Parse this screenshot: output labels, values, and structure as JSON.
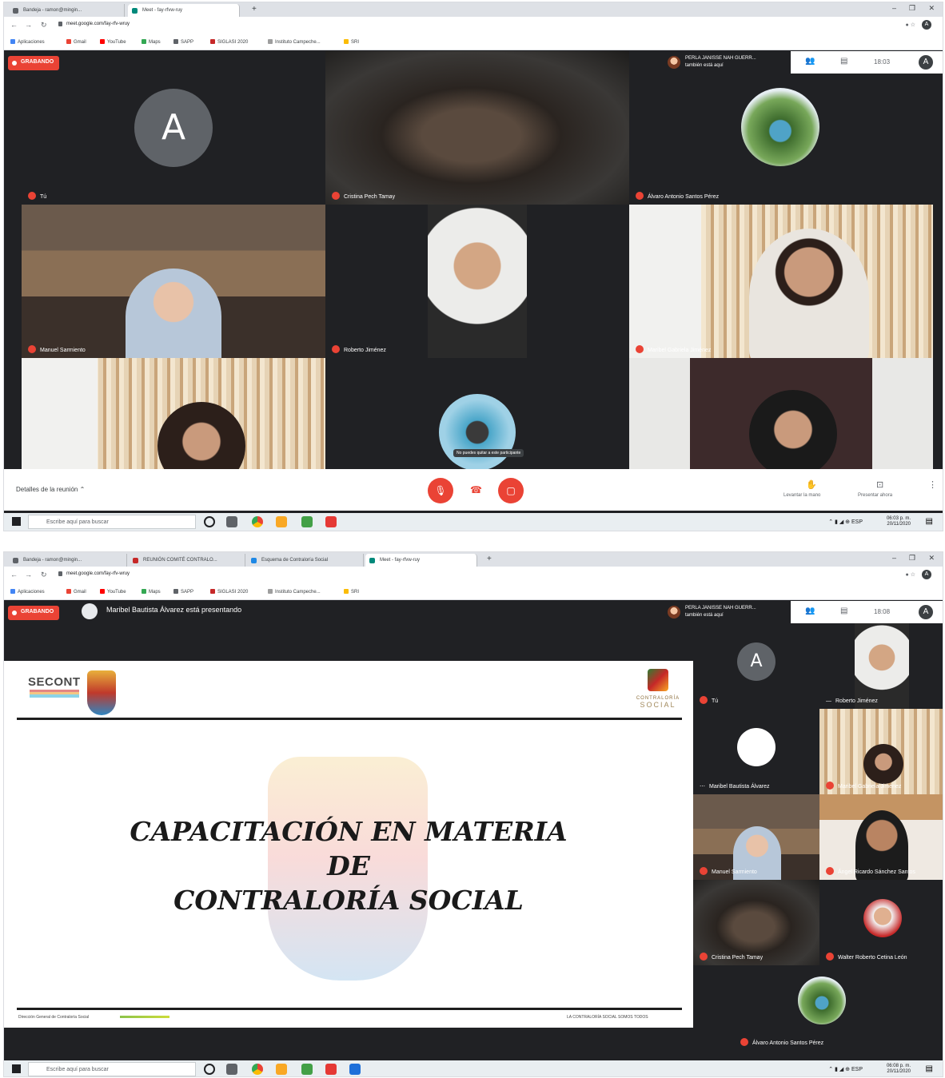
{
  "shot1": {
    "tabs": [
      {
        "label": "Bandeja - ramon@mingin..."
      },
      {
        "label": "Meet - fay-rfvw-ruy"
      }
    ],
    "url": "meet.google.com/fay-rfv-wruy",
    "bookmarks": [
      "Aplicaciones",
      "Gmail",
      "YouTube",
      "Maps",
      "SAPP",
      "SIGLASI 2020",
      "Instituto Campeche...",
      "SRI"
    ],
    "recording_label": "GRABANDO",
    "presenter": {
      "line1": "PERLA JANISSE NAH GUERR...",
      "line2": "también está aquí"
    },
    "clock": "18:03",
    "me_initial": "A",
    "tiles": [
      {
        "name": "Tú",
        "kind": "avatar",
        "initial": "A"
      },
      {
        "name": "Cristina Pech Tamay",
        "kind": "video"
      },
      {
        "name": "Álvaro Antonio Santos Pérez",
        "kind": "photo"
      },
      {
        "name": "Manuel Sarmiento",
        "kind": "video"
      },
      {
        "name": "Roberto Jiménez",
        "kind": "video"
      },
      {
        "name": "Maribel Gabriela Jiménez",
        "kind": "video"
      },
      {
        "name": "",
        "kind": "video"
      },
      {
        "name": "No puedes quitar a este participante",
        "kind": "photo"
      },
      {
        "name": "",
        "kind": "video"
      }
    ],
    "controls": {
      "details": "Detalles de la reunión",
      "raise_hand": "Levantar la mano",
      "present": "Presentar ahora"
    },
    "taskbar": {
      "search": "Escribe aquí para buscar",
      "time": "06:03 p. m.",
      "date": "20/11/2020",
      "lang": "ESP"
    }
  },
  "shot2": {
    "tabs": [
      {
        "label": "Bandeja - ramon@mingin..."
      },
      {
        "label": "REUNIÓN COMITÉ CONTRALO..."
      },
      {
        "label": "Esquema de Contraloría Social"
      },
      {
        "label": "Meet - fay-rfvw-ruy"
      }
    ],
    "url": "meet.google.com/fay-rfv-wruy",
    "bookmarks": [
      "Aplicaciones",
      "Gmail",
      "YouTube",
      "Maps",
      "SAPP",
      "SIGLASI 2020",
      "Instituto Campeche...",
      "SRI"
    ],
    "recording_label": "GRABANDO",
    "presenting": "Maribel Bautista Álvarez está presentando",
    "presenter": {
      "line1": "PERLA JANISSE NAH GUERR...",
      "line2": "también está aquí"
    },
    "clock": "18:08",
    "me_initial": "A",
    "slide": {
      "brand": "SECONT",
      "cs_logo_line1": "CONTRALORÍA",
      "cs_logo_line2": "SOCIAL",
      "title_lines": [
        "CAPACITACIÓN EN MATERIA",
        "DE",
        "CONTRALORÍA SOCIAL"
      ],
      "footer_left": "Dirección General de Contraloría Social",
      "footer_right": "LA CONTRALORÍA SOCIAL SOMOS TODOS"
    },
    "side_tiles": [
      {
        "name": "Tú",
        "kind": "avatar",
        "initial": "A"
      },
      {
        "name": "Roberto Jiménez",
        "kind": "video"
      },
      {
        "name": "Maribel Bautista Álvarez",
        "kind": "logo"
      },
      {
        "name": "Maribel Gabriela Jiménez",
        "kind": "video"
      },
      {
        "name": "Manuel Sarmiento",
        "kind": "video"
      },
      {
        "name": "Ángel Ricardo Sánchez Santos",
        "kind": "video"
      },
      {
        "name": "Cristina Pech Tamay",
        "kind": "video"
      },
      {
        "name": "Walter Roberto Cetina León",
        "kind": "photo"
      },
      {
        "name": "Álvaro Antonio Santos Pérez",
        "kind": "photo"
      }
    ],
    "taskbar": {
      "search": "Escribe aquí para buscar",
      "time": "06:08 p. m.",
      "date": "20/11/2020",
      "lang": "ESP"
    }
  }
}
